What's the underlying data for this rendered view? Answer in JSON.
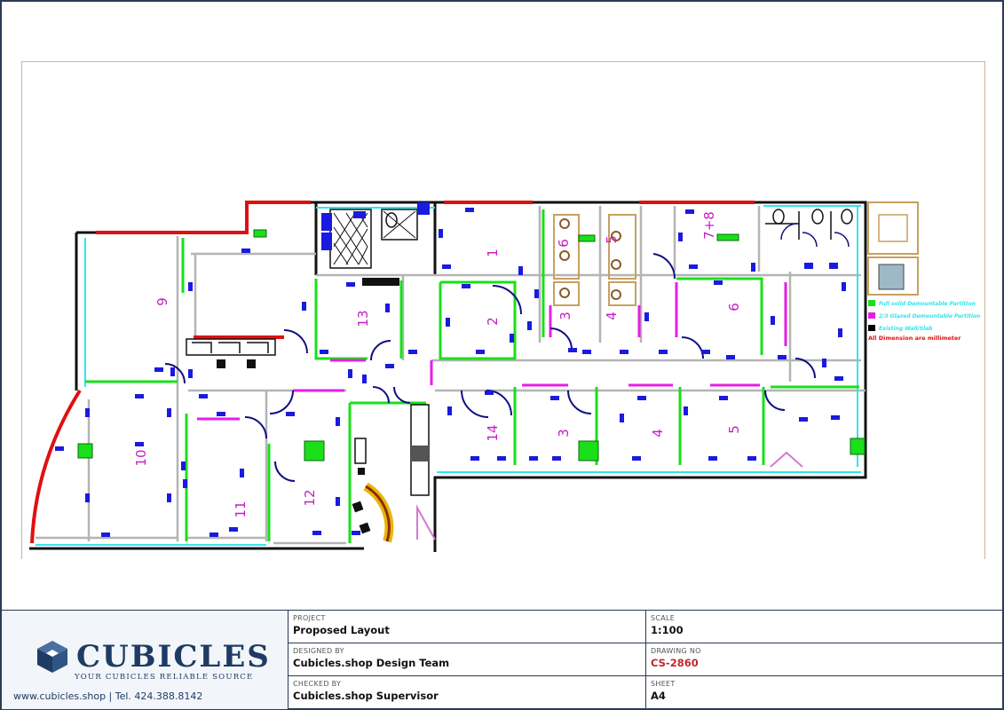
{
  "drawing": {
    "rooms": [
      "1",
      "2",
      "3",
      "4",
      "5",
      "6",
      "7+8",
      "9",
      "10",
      "11",
      "12",
      "13",
      "14",
      "3",
      "4",
      "5",
      "6"
    ],
    "legend": {
      "items": [
        {
          "text": "Full solid Demountable Partition",
          "color": "#19e019"
        },
        {
          "text": "2/3 Glazed Demountable Partition",
          "color": "#e61ee6"
        },
        {
          "text": "Existing Wall/Slab",
          "color": "#000000"
        }
      ],
      "note": "All Dimension are millimeter"
    },
    "colors": {
      "wall": "#111111",
      "existing_red": "#e01010",
      "solid_partition": "#19e019",
      "glazed_partition": "#e61ee6",
      "gray_partition": "#b4b4b4",
      "cyan": "#2ee6ee",
      "door": "#101080",
      "label": "#c41fc4"
    }
  },
  "titleblock": {
    "logo_text": "CUBICLES",
    "tagline": "YOUR CUBICLES RELIABLE SOURCE",
    "contact": "www.cubicles.shop  |  Tel. 424.388.8142",
    "project_label": "PROJECT",
    "project_value": "Proposed Layout",
    "scale_label": "SCALE",
    "scale_value": "1:100",
    "designed_label": "DESIGNED BY",
    "designed_value": "Cubicles.shop Design Team",
    "drawing_no_label": "DRAWING NO",
    "drawing_no_value": "CS-2860",
    "checked_label": "CHECKED BY",
    "checked_value": "Cubicles.shop Supervisor",
    "sheet_label": "SHEET",
    "sheet_value": "A4"
  }
}
